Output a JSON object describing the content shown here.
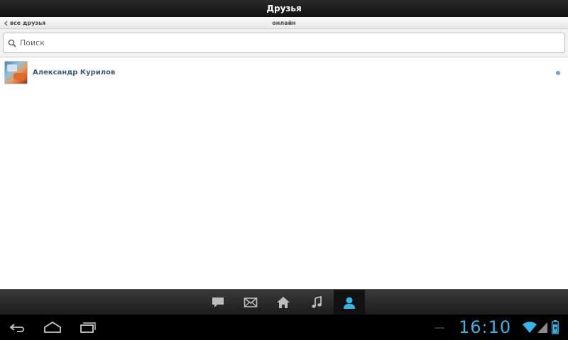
{
  "header": {
    "title": "Друзья"
  },
  "subbar": {
    "back_label": "все друзья",
    "center_label": "онлайн"
  },
  "search": {
    "placeholder": "Поиск"
  },
  "friends": [
    {
      "name": "Александр Курилов",
      "online": true
    }
  ],
  "tabs": [
    {
      "icon": "chat-icon",
      "active": false
    },
    {
      "icon": "mail-icon",
      "active": false
    },
    {
      "icon": "home-icon",
      "active": false
    },
    {
      "icon": "music-icon",
      "active": false
    },
    {
      "icon": "friends-icon",
      "active": true
    }
  ],
  "system": {
    "clock": "16:10"
  },
  "colors": {
    "accent": "#33b5e5",
    "link": "#3d5a7b"
  }
}
